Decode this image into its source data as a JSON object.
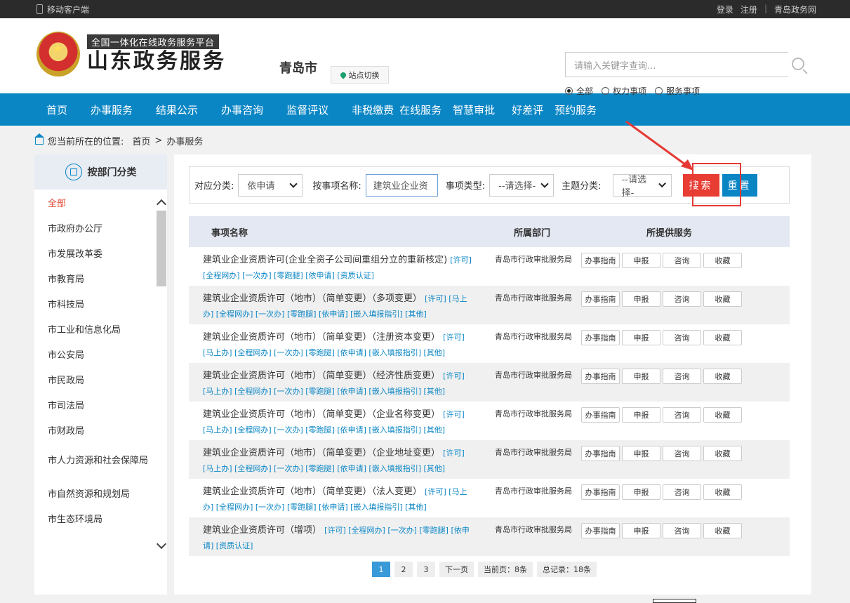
{
  "topbar": {
    "mobile": "移动客户端",
    "login": "登录",
    "register": "注册",
    "sep": "|",
    "site": "青岛政务网"
  },
  "header": {
    "logo_sub": "全国一体化在线政务服务平台",
    "logo_main": "山东政务服务",
    "city": "青岛市",
    "switch_label": "站点切换",
    "search_placeholder": "请输入关键字查询...",
    "radios": [
      {
        "label": "全部",
        "checked": true
      },
      {
        "label": "权力事项",
        "checked": false
      },
      {
        "label": "服务事项",
        "checked": false
      }
    ]
  },
  "nav": [
    "首页",
    "办事服务",
    "结果公示",
    "办事咨询",
    "监督评议",
    "非税缴费",
    "在线服务",
    "智慧审批",
    "好差评",
    "预约服务"
  ],
  "breadcrumb": {
    "prefix": "您当前所在的位置:",
    "home": "首页",
    "sep": ">",
    "current": "办事服务"
  },
  "sidebar": {
    "title": "按部门分类",
    "items": [
      "全部",
      "市政府办公厅",
      "市发展改革委",
      "市教育局",
      "市科技局",
      "市工业和信息化局",
      "市公安局",
      "市民政局",
      "市司法局",
      "市财政局",
      "市人力资源和社会保障局",
      "市自然资源和规划局",
      "市生态环境局"
    ]
  },
  "filter": {
    "category_label": "对应分类:",
    "category_value": "依申请",
    "name_label": "按事项名称:",
    "name_value": "建筑业企业资",
    "type_label": "事项类型:",
    "type_value": "--请选择-",
    "theme_label": "主题分类:",
    "theme_value": "--请选择-",
    "search_btn": "搜索",
    "reset_btn": "重置"
  },
  "table": {
    "headers": {
      "name": "事项名称",
      "dept": "所属部门",
      "service": "所提供服务"
    },
    "service_buttons": [
      "办事指南",
      "申报",
      "咨询",
      "收藏"
    ],
    "rows": [
      {
        "title": "建筑业企业资质许可(企业全资子公司间重组分立的重新核定)",
        "tags": "[许可] [全程网办] [一次办] [零跑腿] [依申请] [资质认证]",
        "dept": "青岛市行政审批服务局"
      },
      {
        "title": "建筑业企业资质许可（地市）（简单变更）（多项变更）",
        "tags": "[许可] [马上办] [全程网办] [一次办] [零跑腿] [依申请] [嵌入填报指引] [其他]",
        "dept": "青岛市行政审批服务局"
      },
      {
        "title": "建筑业企业资质许可（地市）（简单变更）（注册资本变更）",
        "tags": "[许可] [马上办] [全程网办] [一次办] [零跑腿] [依申请] [嵌入填报指引] [其他]",
        "dept": "青岛市行政审批服务局"
      },
      {
        "title": "建筑业企业资质许可（地市）（简单变更）（经济性质变更）",
        "tags": "[许可] [马上办] [全程网办] [一次办] [零跑腿] [依申请] [嵌入填报指引] [其他]",
        "dept": "青岛市行政审批服务局"
      },
      {
        "title": "建筑业企业资质许可（地市）（简单变更）（企业名称变更）",
        "tags": "[许可] [马上办] [全程网办] [一次办] [零跑腿] [依申请] [嵌入填报指引] [其他]",
        "dept": "青岛市行政审批服务局"
      },
      {
        "title": "建筑业企业资质许可（地市）（简单变更）（企业地址变更）",
        "tags": "[许可] [马上办] [全程网办] [一次办] [零跑腿] [依申请] [嵌入填报指引] [其他]",
        "dept": "青岛市行政审批服务局"
      },
      {
        "title": "建筑业企业资质许可（地市）（简单变更）（法人变更）",
        "tags": "[许可] [马上办] [全程网办] [一次办] [零跑腿] [依申请] [嵌入填报指引] [其他]",
        "dept": "青岛市行政审批服务局"
      },
      {
        "title": "建筑业企业资质许可（增项）",
        "tags": "[许可] [全程网办] [一次办] [零跑腿] [依申请] [资质认证]",
        "dept": "青岛市行政审批服务局"
      }
    ]
  },
  "pager": {
    "pages": [
      "1",
      "2",
      "3"
    ],
    "next": "下一页",
    "current_info": "当前页：8条",
    "total_info": "总记录：18条"
  },
  "colors": {
    "nav": "#0a86c5",
    "search": "#e73d33",
    "highlight": "#e53935"
  }
}
